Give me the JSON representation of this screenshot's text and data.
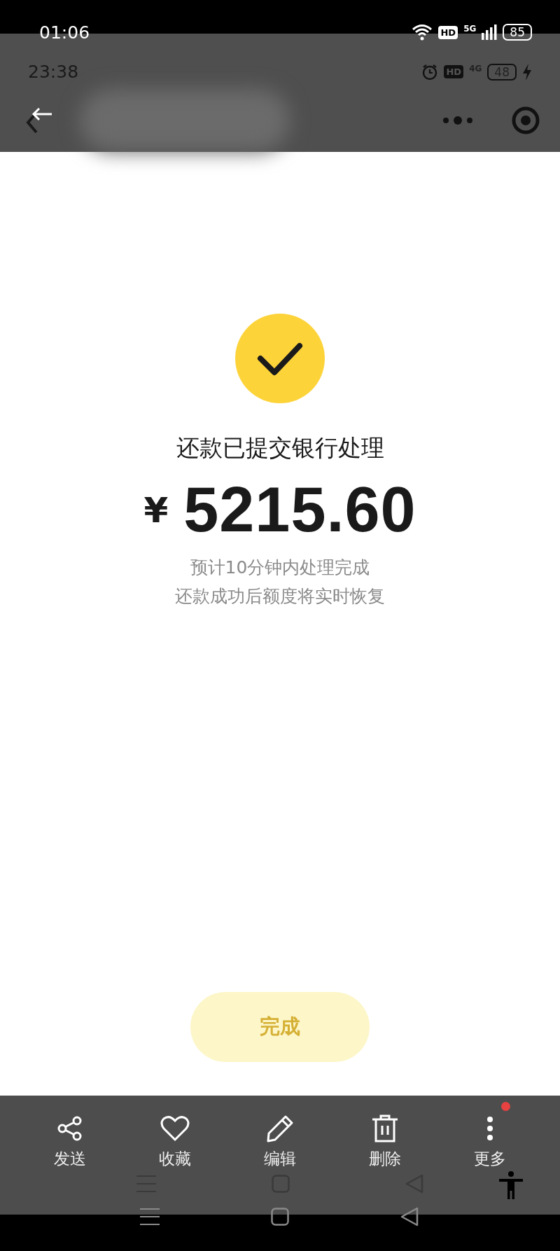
{
  "status_bar": {
    "time": "01:06",
    "hd": "HD",
    "network": "5G",
    "battery": "85"
  },
  "captured_status_bar": {
    "time": "23:38",
    "hd": "HD",
    "network": "4G",
    "battery": "48"
  },
  "result": {
    "title": "还款已提交银行处理",
    "currency": "¥",
    "amount": "5215.60",
    "notes": [
      "预计10分钟内处理完成",
      "还款成功后额度将实时恢复"
    ]
  },
  "done_button": {
    "label": "完成"
  },
  "toolbar": [
    {
      "label": "发送",
      "kind": "share",
      "badge": false
    },
    {
      "label": "收藏",
      "kind": "favorite",
      "badge": false
    },
    {
      "label": "编辑",
      "kind": "edit",
      "badge": false
    },
    {
      "label": "删除",
      "kind": "delete",
      "badge": false
    },
    {
      "label": "更多",
      "kind": "more",
      "badge": true
    }
  ]
}
